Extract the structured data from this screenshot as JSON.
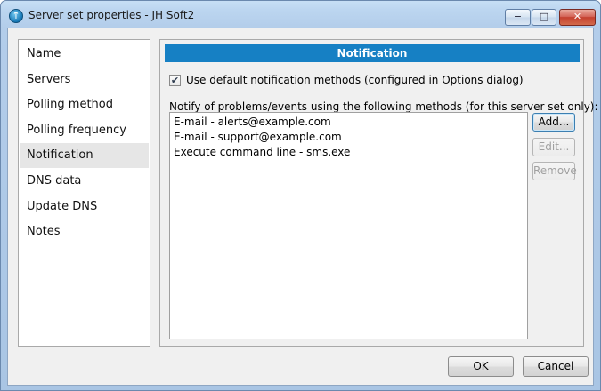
{
  "window": {
    "title": "Server set properties - JH Soft2",
    "controls": {
      "minimize": "−",
      "maximize": "□",
      "close": "✕"
    }
  },
  "nav": {
    "items": [
      {
        "label": "Name"
      },
      {
        "label": "Servers"
      },
      {
        "label": "Polling method"
      },
      {
        "label": "Polling frequency"
      },
      {
        "label": "Notification",
        "selected": true
      },
      {
        "label": "DNS data"
      },
      {
        "label": "Update DNS"
      },
      {
        "label": "Notes"
      }
    ]
  },
  "panel": {
    "header": "Notification",
    "use_default": {
      "checked": true,
      "label": "Use default notification methods (configured in Options dialog)"
    },
    "notify_label": "Notify of problems/events using the following methods (for this server set only):",
    "methods": [
      "E-mail - alerts@example.com",
      "E-mail - support@example.com",
      "Execute command line - sms.exe"
    ],
    "buttons": {
      "add": "Add...",
      "edit": "Edit...",
      "remove": "Remove"
    }
  },
  "footer": {
    "ok": "OK",
    "cancel": "Cancel"
  },
  "colors": {
    "header_bg": "#1680c4",
    "selected_nav_bg": "#e6e6e6",
    "close_button": "#c4402f"
  },
  "icons": {
    "app": "app-logo-icon",
    "check": "checkmark-icon"
  }
}
